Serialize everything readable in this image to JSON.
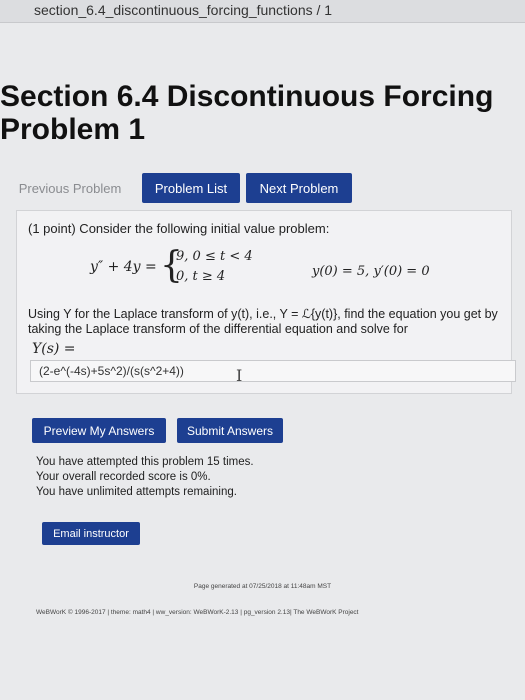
{
  "browser": {
    "tab_title": "section_6.4_discontinuous_forcing_functions / 1"
  },
  "page": {
    "title": "Section 6.4 Discontinuous Forcing\nProblem 1"
  },
  "nav": {
    "previous": "Previous Problem",
    "list": "Problem List",
    "next": "Next Problem"
  },
  "problem": {
    "intro": "(1 point) Consider the following initial value problem:",
    "lhs": "y″ + 4y =",
    "brace": "{",
    "case1": "9,   0 ≤ t < 4",
    "case2": "0,   t ≥ 4",
    "initial": "y(0) = 5,  y′(0) = 0",
    "description": "Using Y for the Laplace transform of y(t), i.e., Y = ℒ{y(t)}, find the equation you get by taking the Laplace transform of the differential equation and solve for",
    "y_label": "Y(s) =",
    "answer_value": "(2-e^(-4s)+5s^2)/(s(s^2+4))",
    "cursor": "I"
  },
  "actions": {
    "preview": "Preview My Answers",
    "submit": "Submit Answers"
  },
  "status": {
    "line1": "You have attempted this problem 15 times.",
    "line2": "Your overall recorded score is 0%.",
    "line3": "You have unlimited attempts remaining."
  },
  "email": {
    "label": "Email instructor"
  },
  "footer": {
    "generated": "Page generated at 07/25/2018 at 11:48am MST",
    "credits": "WeBWorK © 1996-2017 | theme: math4 | ww_version: WeBWorK-2.13 | pg_version 2.13| The WeBWorK Project"
  },
  "colors": {
    "button_blue": "#1d3f91",
    "page_bg": "#e9eaec"
  }
}
